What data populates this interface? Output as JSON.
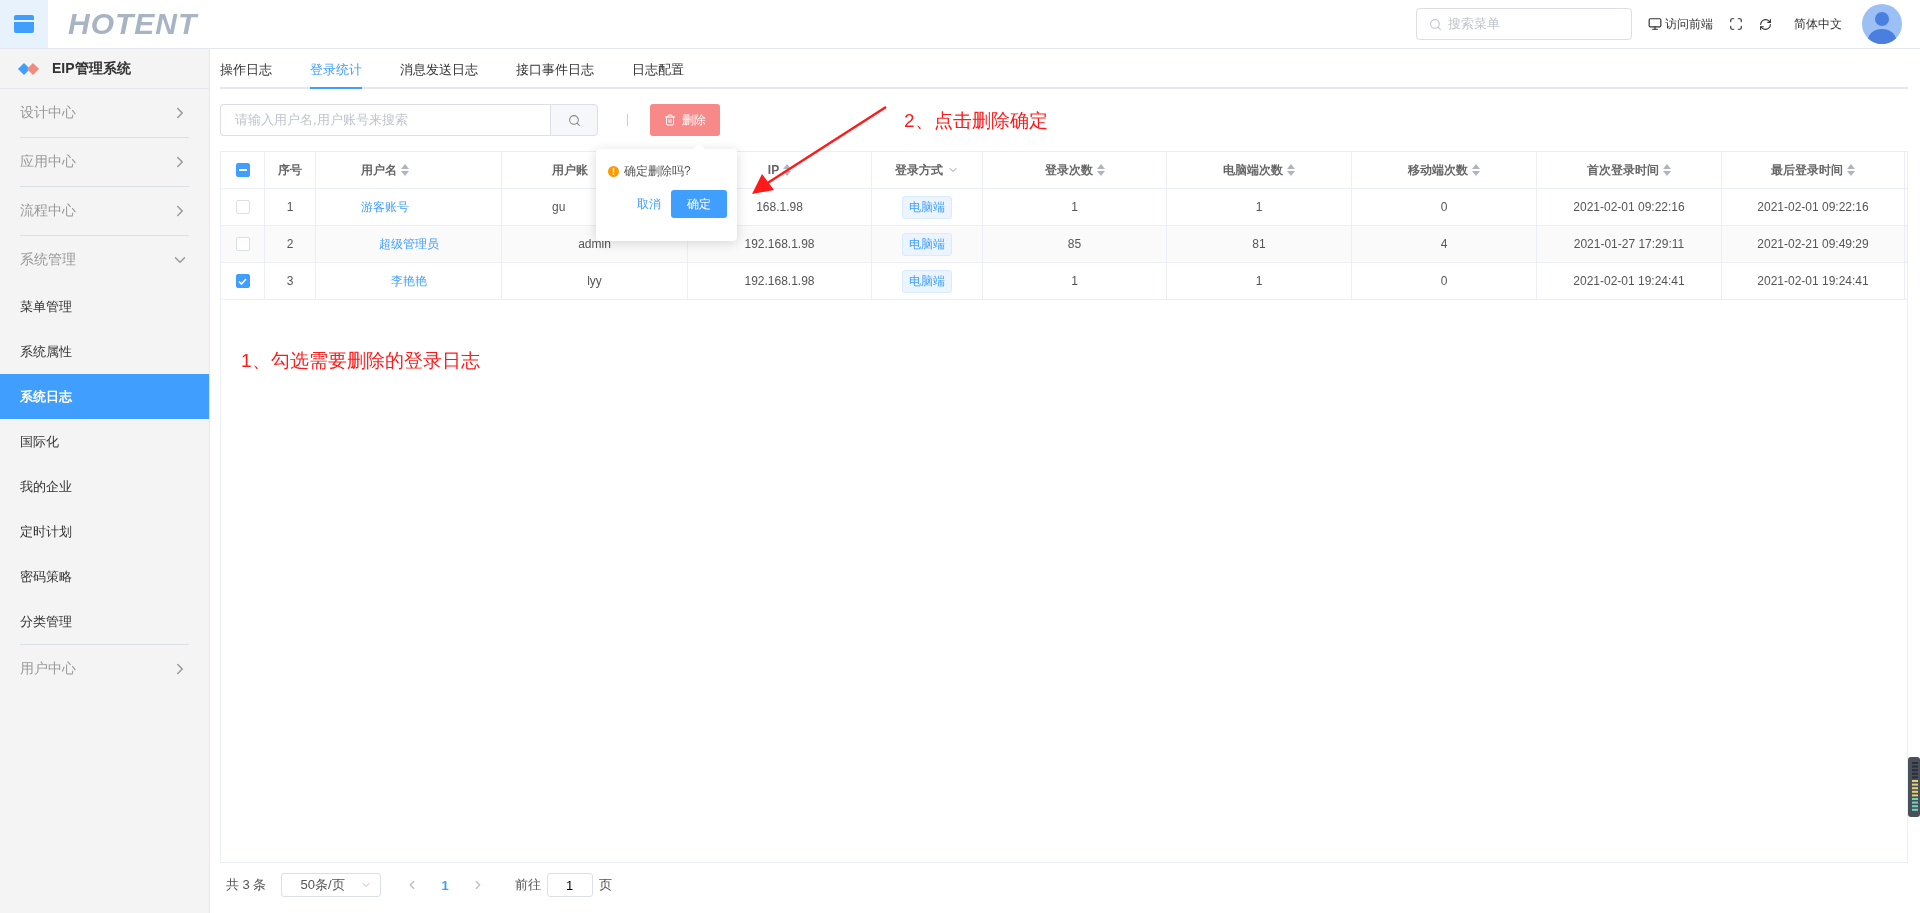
{
  "topbar": {
    "logo": "HOTENT",
    "search": {
      "placeholder": "搜索菜单"
    },
    "front_link": "访问前端",
    "language": "简体中文"
  },
  "sidebar": {
    "brand": "EIP管理系统",
    "groups": [
      {
        "label": "设计中心",
        "expanded": false
      },
      {
        "label": "应用中心",
        "expanded": false
      },
      {
        "label": "流程中心",
        "expanded": false
      },
      {
        "label": "系统管理",
        "expanded": true,
        "children": [
          {
            "label": "菜单管理",
            "selected": false
          },
          {
            "label": "系统属性",
            "selected": false
          },
          {
            "label": "系统日志",
            "selected": true
          },
          {
            "label": "国际化",
            "selected": false
          },
          {
            "label": "我的企业",
            "selected": false
          },
          {
            "label": "定时计划",
            "selected": false
          },
          {
            "label": "密码策略",
            "selected": false
          },
          {
            "label": "分类管理",
            "selected": false
          }
        ]
      },
      {
        "label": "用户中心",
        "expanded": false
      }
    ]
  },
  "tabs": [
    {
      "label": "操作日志",
      "selected": false
    },
    {
      "label": "登录统计",
      "selected": true
    },
    {
      "label": "消息发送日志",
      "selected": false
    },
    {
      "label": "接口事件日志",
      "selected": false
    },
    {
      "label": "日志配置",
      "selected": false
    }
  ],
  "toolbar": {
    "search": {
      "placeholder": "请输入用户名,用户账号来搜索"
    },
    "delete_button": "删除"
  },
  "popconfirm": {
    "message": "确定删除吗?",
    "cancel": "取消",
    "confirm": "确定"
  },
  "table": {
    "header_check": {
      "indeterminate": true
    },
    "columns": [
      {
        "label": "序号",
        "kind": "plain"
      },
      {
        "label": "用户名",
        "kind": "sort"
      },
      {
        "label": "用户账",
        "kind": "plain"
      },
      {
        "label": "IP",
        "kind": "sort"
      },
      {
        "label": "登录方式",
        "kind": "filter"
      },
      {
        "label": "登录次数",
        "kind": "sort"
      },
      {
        "label": "电脑端次数",
        "kind": "sort"
      },
      {
        "label": "移动端次数",
        "kind": "sort"
      },
      {
        "label": "首次登录时间",
        "kind": "sort"
      },
      {
        "label": "最后登录时间",
        "kind": "sort"
      }
    ],
    "rows": [
      {
        "checked": false,
        "cells": [
          {
            "text": "1"
          },
          {
            "text": "游客账号",
            "kind": "link"
          },
          {
            "text": "gu"
          },
          {
            "text": "168.1.98"
          },
          {
            "text": "电脑端",
            "kind": "tag"
          },
          {
            "text": "1"
          },
          {
            "text": "1"
          },
          {
            "text": "0"
          },
          {
            "text": "2021-02-01 09:22:16"
          },
          {
            "text": "2021-02-01 09:22:16"
          }
        ]
      },
      {
        "checked": false,
        "cells": [
          {
            "text": "2"
          },
          {
            "text": "超级管理员",
            "kind": "link"
          },
          {
            "text": "admin"
          },
          {
            "text": "192.168.1.98"
          },
          {
            "text": "电脑端",
            "kind": "tag"
          },
          {
            "text": "85"
          },
          {
            "text": "81"
          },
          {
            "text": "4"
          },
          {
            "text": "2021-01-27 17:29:11"
          },
          {
            "text": "2021-02-21 09:49:29"
          }
        ]
      },
      {
        "checked": true,
        "cells": [
          {
            "text": "3"
          },
          {
            "text": "李艳艳",
            "kind": "link"
          },
          {
            "text": "lyy"
          },
          {
            "text": "192.168.1.98"
          },
          {
            "text": "电脑端",
            "kind": "tag"
          },
          {
            "text": "1"
          },
          {
            "text": "1"
          },
          {
            "text": "0"
          },
          {
            "text": "2021-02-01 19:24:41"
          },
          {
            "text": "2021-02-01 19:24:41"
          }
        ]
      }
    ]
  },
  "pagination": {
    "total": "共 3 条",
    "page_size": "50条/页",
    "pages": [
      {
        "label": "1",
        "selected": true
      }
    ],
    "goto_label": "前往",
    "goto_value": "1",
    "goto_suffix": "页"
  },
  "annotations": [
    {
      "text": "1、勾选需要删除的登录日志"
    },
    {
      "text": "2、点击删除确定"
    }
  ]
}
